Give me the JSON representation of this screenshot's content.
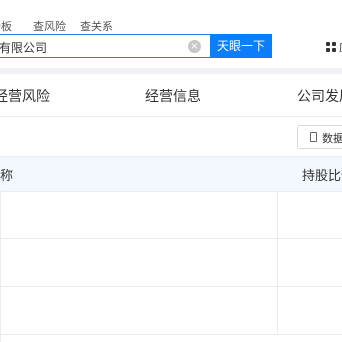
{
  "top_tabs": [
    "老板",
    "查风险",
    "查关系"
  ],
  "search": {
    "value": "有限公司",
    "button_label": "天眼一下"
  },
  "apps": {
    "label": "应"
  },
  "tabs": [
    "经营风险",
    "经营信息",
    "公司发展"
  ],
  "export": {
    "label": "数据"
  },
  "table": {
    "headers": [
      "称",
      "持股比例"
    ],
    "rows": [
      [
        "",
        ""
      ],
      [
        "",
        ""
      ],
      [
        "",
        ""
      ]
    ]
  }
}
